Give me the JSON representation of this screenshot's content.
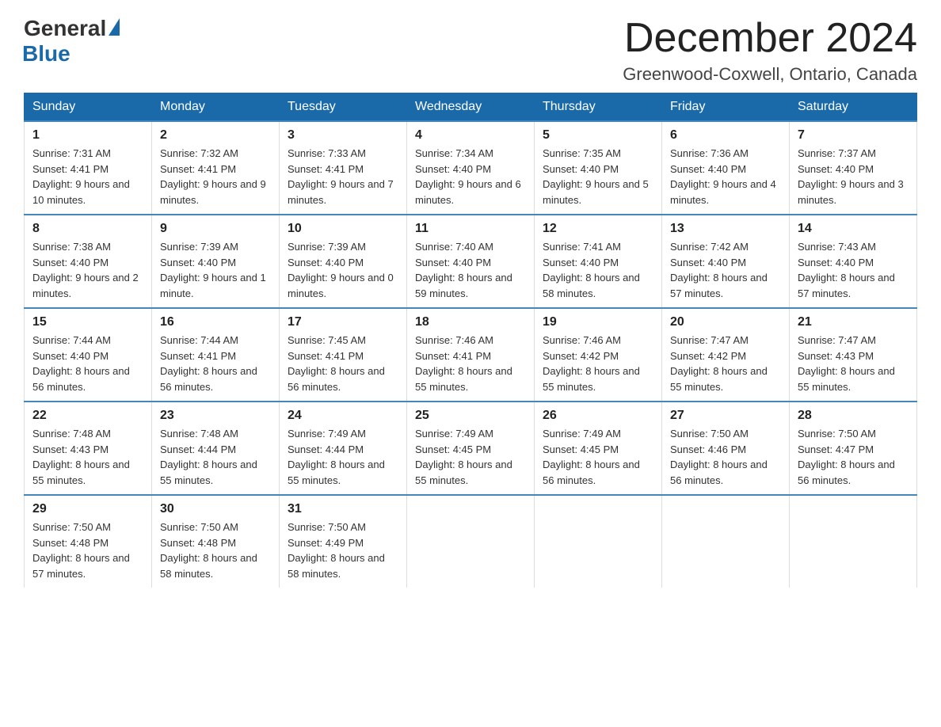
{
  "header": {
    "logo_general": "General",
    "logo_blue": "Blue",
    "month_title": "December 2024",
    "location": "Greenwood-Coxwell, Ontario, Canada"
  },
  "days_of_week": [
    "Sunday",
    "Monday",
    "Tuesday",
    "Wednesday",
    "Thursday",
    "Friday",
    "Saturday"
  ],
  "weeks": [
    [
      {
        "day": "1",
        "sunrise": "7:31 AM",
        "sunset": "4:41 PM",
        "daylight": "9 hours and 10 minutes."
      },
      {
        "day": "2",
        "sunrise": "7:32 AM",
        "sunset": "4:41 PM",
        "daylight": "9 hours and 9 minutes."
      },
      {
        "day": "3",
        "sunrise": "7:33 AM",
        "sunset": "4:41 PM",
        "daylight": "9 hours and 7 minutes."
      },
      {
        "day": "4",
        "sunrise": "7:34 AM",
        "sunset": "4:40 PM",
        "daylight": "9 hours and 6 minutes."
      },
      {
        "day": "5",
        "sunrise": "7:35 AM",
        "sunset": "4:40 PM",
        "daylight": "9 hours and 5 minutes."
      },
      {
        "day": "6",
        "sunrise": "7:36 AM",
        "sunset": "4:40 PM",
        "daylight": "9 hours and 4 minutes."
      },
      {
        "day": "7",
        "sunrise": "7:37 AM",
        "sunset": "4:40 PM",
        "daylight": "9 hours and 3 minutes."
      }
    ],
    [
      {
        "day": "8",
        "sunrise": "7:38 AM",
        "sunset": "4:40 PM",
        "daylight": "9 hours and 2 minutes."
      },
      {
        "day": "9",
        "sunrise": "7:39 AM",
        "sunset": "4:40 PM",
        "daylight": "9 hours and 1 minute."
      },
      {
        "day": "10",
        "sunrise": "7:39 AM",
        "sunset": "4:40 PM",
        "daylight": "9 hours and 0 minutes."
      },
      {
        "day": "11",
        "sunrise": "7:40 AM",
        "sunset": "4:40 PM",
        "daylight": "8 hours and 59 minutes."
      },
      {
        "day": "12",
        "sunrise": "7:41 AM",
        "sunset": "4:40 PM",
        "daylight": "8 hours and 58 minutes."
      },
      {
        "day": "13",
        "sunrise": "7:42 AM",
        "sunset": "4:40 PM",
        "daylight": "8 hours and 57 minutes."
      },
      {
        "day": "14",
        "sunrise": "7:43 AM",
        "sunset": "4:40 PM",
        "daylight": "8 hours and 57 minutes."
      }
    ],
    [
      {
        "day": "15",
        "sunrise": "7:44 AM",
        "sunset": "4:40 PM",
        "daylight": "8 hours and 56 minutes."
      },
      {
        "day": "16",
        "sunrise": "7:44 AM",
        "sunset": "4:41 PM",
        "daylight": "8 hours and 56 minutes."
      },
      {
        "day": "17",
        "sunrise": "7:45 AM",
        "sunset": "4:41 PM",
        "daylight": "8 hours and 56 minutes."
      },
      {
        "day": "18",
        "sunrise": "7:46 AM",
        "sunset": "4:41 PM",
        "daylight": "8 hours and 55 minutes."
      },
      {
        "day": "19",
        "sunrise": "7:46 AM",
        "sunset": "4:42 PM",
        "daylight": "8 hours and 55 minutes."
      },
      {
        "day": "20",
        "sunrise": "7:47 AM",
        "sunset": "4:42 PM",
        "daylight": "8 hours and 55 minutes."
      },
      {
        "day": "21",
        "sunrise": "7:47 AM",
        "sunset": "4:43 PM",
        "daylight": "8 hours and 55 minutes."
      }
    ],
    [
      {
        "day": "22",
        "sunrise": "7:48 AM",
        "sunset": "4:43 PM",
        "daylight": "8 hours and 55 minutes."
      },
      {
        "day": "23",
        "sunrise": "7:48 AM",
        "sunset": "4:44 PM",
        "daylight": "8 hours and 55 minutes."
      },
      {
        "day": "24",
        "sunrise": "7:49 AM",
        "sunset": "4:44 PM",
        "daylight": "8 hours and 55 minutes."
      },
      {
        "day": "25",
        "sunrise": "7:49 AM",
        "sunset": "4:45 PM",
        "daylight": "8 hours and 55 minutes."
      },
      {
        "day": "26",
        "sunrise": "7:49 AM",
        "sunset": "4:45 PM",
        "daylight": "8 hours and 56 minutes."
      },
      {
        "day": "27",
        "sunrise": "7:50 AM",
        "sunset": "4:46 PM",
        "daylight": "8 hours and 56 minutes."
      },
      {
        "day": "28",
        "sunrise": "7:50 AM",
        "sunset": "4:47 PM",
        "daylight": "8 hours and 56 minutes."
      }
    ],
    [
      {
        "day": "29",
        "sunrise": "7:50 AM",
        "sunset": "4:48 PM",
        "daylight": "8 hours and 57 minutes."
      },
      {
        "day": "30",
        "sunrise": "7:50 AM",
        "sunset": "4:48 PM",
        "daylight": "8 hours and 58 minutes."
      },
      {
        "day": "31",
        "sunrise": "7:50 AM",
        "sunset": "4:49 PM",
        "daylight": "8 hours and 58 minutes."
      },
      null,
      null,
      null,
      null
    ]
  ]
}
